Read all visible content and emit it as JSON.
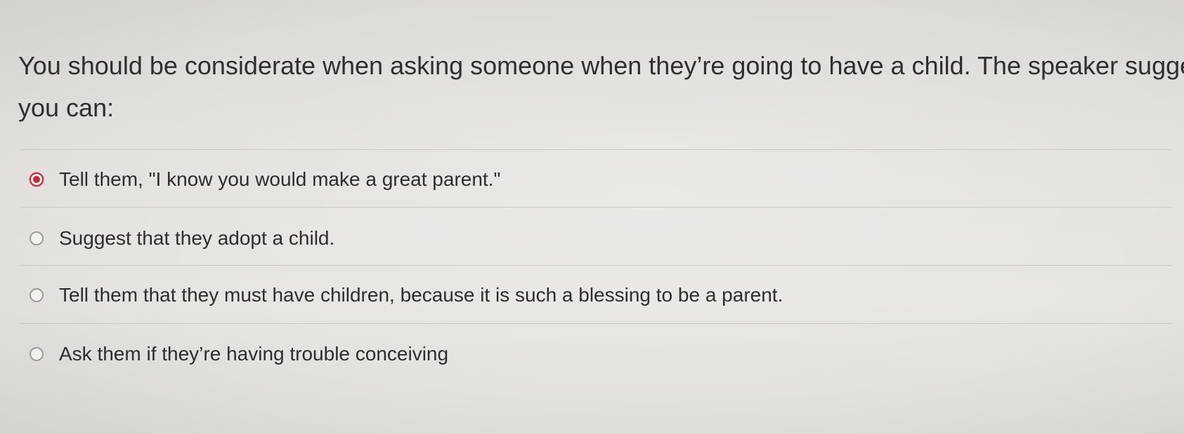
{
  "question": {
    "line1": "You should be considerate when asking someone when they’re going to have a child. The speaker suggest",
    "line2": "you can:"
  },
  "options": [
    {
      "label": "Tell them, \"I know you would make a great parent.\"",
      "selected": true
    },
    {
      "label": "Suggest that they adopt a child.",
      "selected": false
    },
    {
      "label": "Tell them that they must have children, because it is such a blessing to be a parent.",
      "selected": false
    },
    {
      "label": "Ask them if they’re having trouble conceiving",
      "selected": false
    }
  ],
  "colors": {
    "accent": "#c8243a",
    "background": "#e3e2de"
  }
}
